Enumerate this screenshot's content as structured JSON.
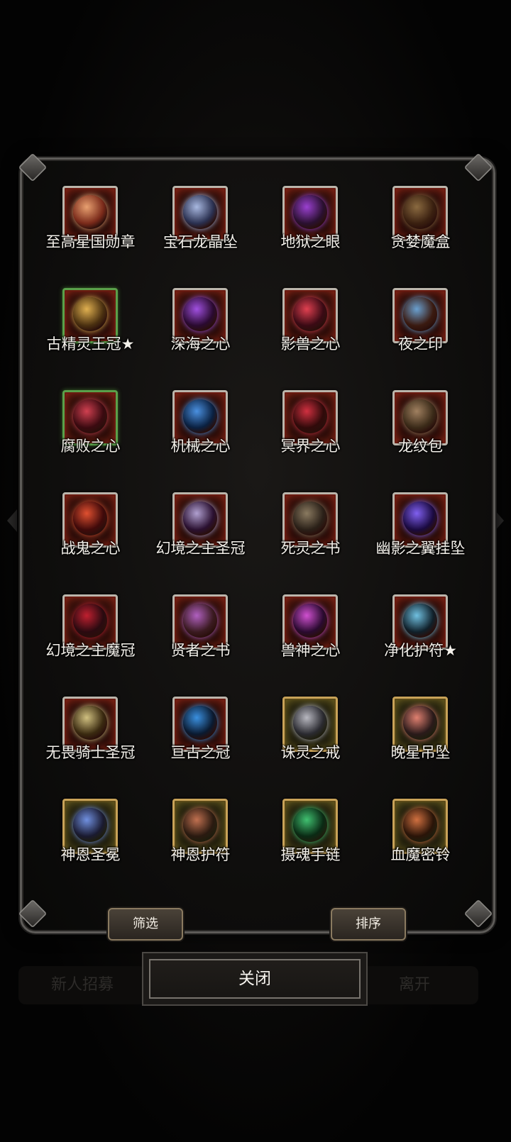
{
  "items": [
    {
      "label": "至高星国勋章",
      "frame": "red",
      "icon": "medal-icon",
      "colors": [
        "#e8a070",
        "#7a2a1a"
      ]
    },
    {
      "label": "宝石龙晶坠",
      "frame": "red",
      "icon": "dragon-pendant-icon",
      "colors": [
        "#a8b8e0",
        "#2a3050"
      ]
    },
    {
      "label": "地狱之眼",
      "frame": "red",
      "icon": "eye-amulet-icon",
      "colors": [
        "#9a40d0",
        "#2a1030"
      ]
    },
    {
      "label": "贪婪魔盒",
      "frame": "red",
      "icon": "mimic-chest-icon",
      "colors": [
        "#8a6a40",
        "#3a2010"
      ]
    },
    {
      "label": "古精灵王冠★",
      "frame": "green",
      "icon": "crown-icon",
      "colors": [
        "#e0b050",
        "#4a3010"
      ]
    },
    {
      "label": "深海之心",
      "frame": "red",
      "icon": "necklace-icon",
      "colors": [
        "#a050e0",
        "#2a0a30"
      ]
    },
    {
      "label": "影兽之心",
      "frame": "red",
      "icon": "beast-heart-icon",
      "colors": [
        "#e04050",
        "#3a0a14"
      ]
    },
    {
      "label": "夜之印",
      "frame": "red",
      "icon": "seal-stamp-icon",
      "colors": [
        "#6aa0d0",
        "#3a1a10"
      ]
    },
    {
      "label": "腐败之心",
      "frame": "green",
      "icon": "corrupt-heart-icon",
      "colors": [
        "#d04050",
        "#3a0a10"
      ]
    },
    {
      "label": "机械之心",
      "frame": "red",
      "icon": "blue-crystal-icon",
      "colors": [
        "#4a90e0",
        "#0a2040"
      ]
    },
    {
      "label": "冥界之心",
      "frame": "red",
      "icon": "red-ring-icon",
      "colors": [
        "#d03040",
        "#300a0a"
      ]
    },
    {
      "label": "龙纹包",
      "frame": "red",
      "icon": "bag-icon",
      "colors": [
        "#a08060",
        "#3a2a18"
      ]
    },
    {
      "label": "战鬼之心",
      "frame": "red",
      "icon": "blood-heart-icon",
      "colors": [
        "#e05030",
        "#400a0a"
      ]
    },
    {
      "label": "幻境之主圣冠",
      "frame": "red",
      "icon": "dark-crown-icon",
      "colors": [
        "#b0a0d0",
        "#2a1030"
      ]
    },
    {
      "label": "死灵之书",
      "frame": "red",
      "icon": "tome-icon",
      "colors": [
        "#8a7a60",
        "#2a2018"
      ]
    },
    {
      "label": "幽影之翼挂坠",
      "frame": "red",
      "icon": "wing-pendant-icon",
      "colors": [
        "#8060f0",
        "#1a0a40"
      ]
    },
    {
      "label": "幻境之主魔冠",
      "frame": "red",
      "icon": "demon-crown-icon",
      "colors": [
        "#c02030",
        "#2a0a10"
      ]
    },
    {
      "label": "贤者之书",
      "frame": "red",
      "icon": "sage-book-icon",
      "colors": [
        "#b060c0",
        "#3a1a20"
      ]
    },
    {
      "label": "兽神之心",
      "frame": "red",
      "icon": "beast-god-heart-icon",
      "colors": [
        "#d050d0",
        "#2a0a30"
      ]
    },
    {
      "label": "净化护符★",
      "frame": "red",
      "icon": "talisman-icon",
      "colors": [
        "#70c0e0",
        "#10202a"
      ]
    },
    {
      "label": "无畏骑士圣冠",
      "frame": "red",
      "icon": "knight-helm-icon",
      "colors": [
        "#d0c080",
        "#3a2a10"
      ]
    },
    {
      "label": "亘古之冠",
      "frame": "red",
      "icon": "ancient-crown-icon",
      "colors": [
        "#3a90e0",
        "#0a1a30"
      ]
    },
    {
      "label": "诛灵之戒",
      "frame": "gold",
      "icon": "silver-ring-icon",
      "colors": [
        "#b8b8c0",
        "#2a2a30"
      ]
    },
    {
      "label": "晚星吊坠",
      "frame": "gold",
      "icon": "star-pendant-icon",
      "colors": [
        "#e08070",
        "#2a1a1a"
      ]
    },
    {
      "label": "神恩圣冕",
      "frame": "gold",
      "icon": "holy-crown-icon",
      "colors": [
        "#7090e0",
        "#1a1a30"
      ]
    },
    {
      "label": "神恩护符",
      "frame": "gold",
      "icon": "holy-amulet-icon",
      "colors": [
        "#c07050",
        "#2a1a10"
      ]
    },
    {
      "label": "摄魂手链",
      "frame": "gold",
      "icon": "bracelet-icon",
      "colors": [
        "#40c070",
        "#0a2a14"
      ]
    },
    {
      "label": "血魔密铃",
      "frame": "gold",
      "icon": "bell-icon",
      "colors": [
        "#d07040",
        "#2a1408"
      ]
    }
  ],
  "buttons": {
    "filter": "筛选",
    "sort": "排序",
    "close": "关闭",
    "bg_left": "新人招募",
    "bg_right": "离开"
  }
}
